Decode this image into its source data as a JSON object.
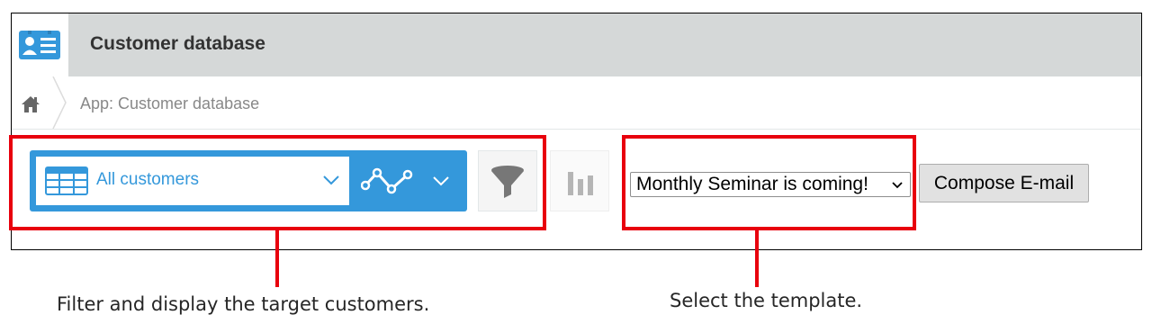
{
  "app": {
    "title": "Customer database",
    "icon": "contact-card-icon"
  },
  "breadcrumb": {
    "home_icon": "home-icon",
    "items": [
      "App: Customer database"
    ]
  },
  "toolbar": {
    "view": {
      "label": "All customers",
      "icon": "table-icon"
    },
    "graph_view_icon": "line-graph-icon",
    "filter_icon": "funnel-icon",
    "chart_icon": "bar-chart-icon",
    "template_select": {
      "selected": "Monthly Seminar is coming!"
    },
    "compose_button": "Compose E-mail"
  },
  "annotations": {
    "left": "Filter and display the target customers.",
    "right": "Select the template."
  },
  "colors": {
    "accent": "#3498db",
    "title_bar": "#d5d8d8",
    "callout": "#e8000d"
  }
}
